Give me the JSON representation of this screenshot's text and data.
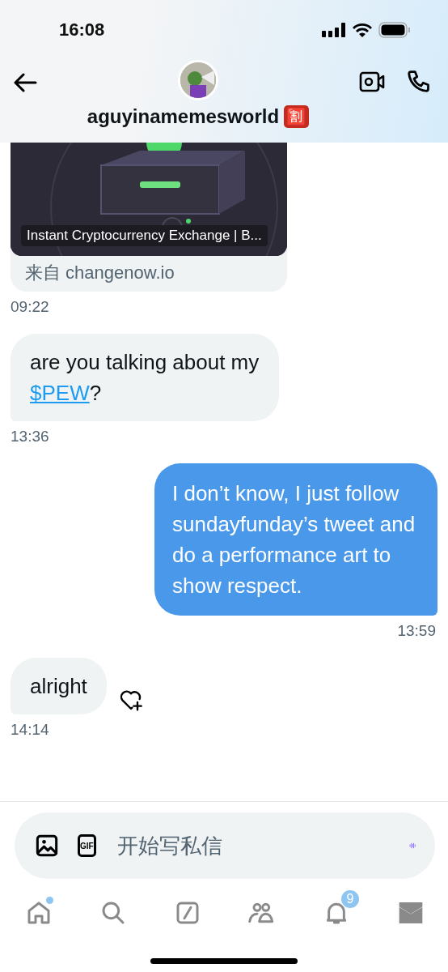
{
  "status_bar": {
    "time": "16:08"
  },
  "header": {
    "name": "aguyinamemesworld",
    "emoji": "🈹"
  },
  "link_card": {
    "title": "Instant Cryptocurrency Exchange | B...",
    "source": "来自 changenow.io",
    "time": "09:22"
  },
  "messages": [
    {
      "kind": "received",
      "parts": [
        {
          "kind": "text",
          "text": "are you talking about my "
        },
        {
          "kind": "link",
          "text": "$PEW"
        },
        {
          "kind": "text",
          "text": "?"
        }
      ],
      "time": "13:36",
      "reaction_button": false
    },
    {
      "kind": "sent",
      "parts": [
        {
          "kind": "text",
          "text": "I don’t know, I just follow sundayfunday’s tweet and do a performance art to show respect."
        }
      ],
      "time": "13:59",
      "reaction_button": false
    },
    {
      "kind": "received",
      "parts": [
        {
          "kind": "text",
          "text": "alright"
        }
      ],
      "time": "14:14",
      "reaction_button": true
    }
  ],
  "composer": {
    "gif_label": "GIF",
    "placeholder": "开始写私信"
  },
  "nav": [
    {
      "kind": "home",
      "selected": false,
      "dot": true
    },
    {
      "kind": "search",
      "selected": false,
      "dot": false
    },
    {
      "kind": "grok",
      "selected": false,
      "dot": false
    },
    {
      "kind": "communities",
      "selected": false,
      "dot": false
    },
    {
      "kind": "notifications",
      "selected": false,
      "dot": false,
      "badge": "9"
    },
    {
      "kind": "messages",
      "selected": true,
      "dot": false
    }
  ]
}
